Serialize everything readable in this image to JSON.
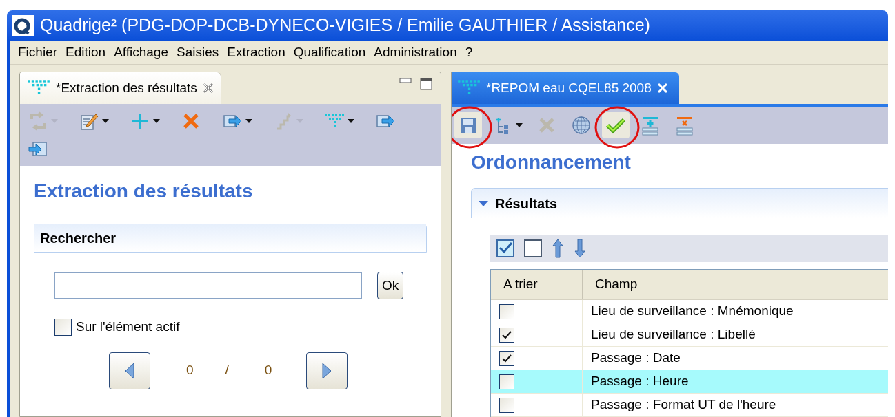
{
  "window": {
    "title": "Quadrige² (PDG-DOP-DCB-DYNECO-VIGIES / Emilie GAUTHIER / Assistance)"
  },
  "menu": [
    "Fichier",
    "Edition",
    "Affichage",
    "Saisies",
    "Extraction",
    "Qualification",
    "Administration",
    "?"
  ],
  "left_panel": {
    "tab": {
      "label": "*Extraction des résultats",
      "selected": false
    },
    "toolbar": [
      {
        "kind": "sync",
        "disabled": true,
        "dropdown": true,
        "circled": false
      },
      {
        "kind": "edit",
        "disabled": false,
        "dropdown": true,
        "circled": false
      },
      {
        "kind": "add",
        "disabled": false,
        "dropdown": true,
        "circled": false
      },
      {
        "kind": "delete",
        "disabled": false,
        "dropdown": false,
        "circled": false
      },
      {
        "kind": "export",
        "disabled": false,
        "dropdown": true,
        "circled": false
      },
      {
        "kind": "steps",
        "disabled": true,
        "dropdown": true,
        "circled": false
      },
      {
        "kind": "filter",
        "disabled": false,
        "dropdown": true,
        "circled": false
      },
      {
        "kind": "export",
        "disabled": false,
        "dropdown": false,
        "circled": false
      },
      {
        "kind": "import",
        "disabled": false,
        "dropdown": false,
        "circled": false
      }
    ],
    "heading": "Extraction des résultats",
    "search_section": {
      "title": "Rechercher",
      "ok_button": "Ok",
      "active_element": {
        "label": "Sur l'élément actif",
        "checked": false
      },
      "pager": {
        "current": "0",
        "separator": "/",
        "total": "0"
      }
    }
  },
  "right_panel": {
    "tab": {
      "label": "*REPOM eau CQEL85 2008",
      "selected": true
    },
    "toolbar": [
      {
        "kind": "save",
        "disabled": false,
        "dropdown": false,
        "circled": true
      },
      {
        "kind": "tree",
        "disabled": false,
        "dropdown": true,
        "circled": false
      },
      {
        "kind": "delete",
        "disabled": true,
        "dropdown": false,
        "circled": false
      },
      {
        "kind": "globe",
        "disabled": false,
        "dropdown": false,
        "circled": false
      },
      {
        "kind": "validate",
        "disabled": false,
        "dropdown": false,
        "circled": true
      },
      {
        "kind": "add-row",
        "disabled": false,
        "dropdown": false,
        "circled": false
      },
      {
        "kind": "remove-row",
        "disabled": false,
        "dropdown": false,
        "circled": false
      }
    ],
    "heading": "Ordonnancement",
    "section": {
      "title": "Résultats",
      "expanded": true
    },
    "table_toolbar": [
      {
        "kind": "check-all"
      },
      {
        "kind": "uncheck-all"
      },
      {
        "kind": "up"
      },
      {
        "kind": "down"
      }
    ],
    "table": {
      "columns": [
        "A trier",
        "Champ"
      ],
      "rows": [
        {
          "checked": false,
          "field": "Lieu de surveillance : Mnémonique",
          "selected": false
        },
        {
          "checked": true,
          "field": "Lieu de surveillance : Libellé",
          "selected": false
        },
        {
          "checked": true,
          "field": "Passage : Date",
          "selected": false
        },
        {
          "checked": false,
          "field": "Passage : Heure",
          "selected": true
        },
        {
          "checked": false,
          "field": "Passage : Format UT de l'heure",
          "selected": false
        }
      ]
    }
  }
}
